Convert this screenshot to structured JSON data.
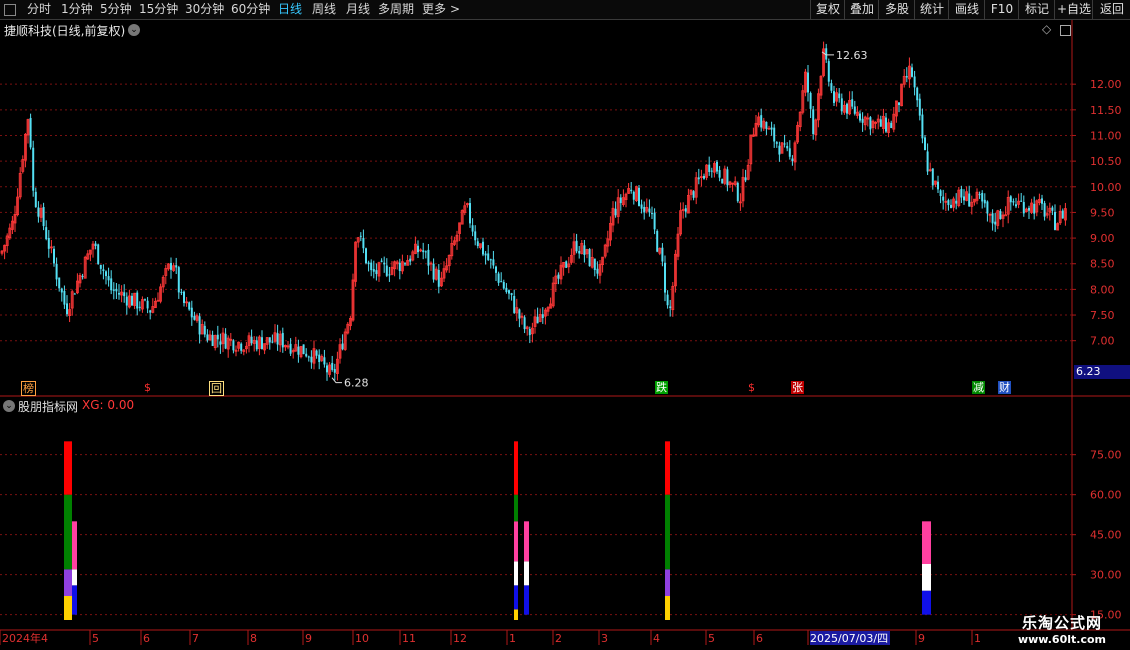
{
  "toolbar": {
    "periods": [
      "分时",
      "1分钟",
      "5分钟",
      "15分钟",
      "30分钟",
      "60分钟",
      "日线",
      "周线",
      "月线",
      "多周期",
      "更多"
    ],
    "active_period": "日线",
    "right_buttons": [
      "复权",
      "叠加",
      "多股",
      "统计",
      "画线",
      "F10",
      "标记",
      "+自选",
      "返回"
    ]
  },
  "main_chart": {
    "title": "捷顺科技(日线,前复权)",
    "high_label": "12.63",
    "low_label": "6.28",
    "current_price": "6.23",
    "y_ticks": [
      "12.00",
      "11.50",
      "11.00",
      "10.50",
      "10.00",
      "9.50",
      "9.00",
      "8.50",
      "8.00",
      "7.50",
      "7.00"
    ],
    "markers": [
      {
        "text": "榜",
        "color": "#ffa040",
        "boxed": true
      },
      {
        "text": "$",
        "color": "#ff3030",
        "boxed": false
      },
      {
        "text": "回",
        "color": "#ffe080",
        "boxed": true
      },
      {
        "text": "跌",
        "color": "#ffffff",
        "bg": "#00a000",
        "boxed": false
      },
      {
        "text": "$",
        "color": "#ff3030",
        "boxed": false
      },
      {
        "text": "张",
        "color": "#ffffff",
        "bg": "#c00000",
        "boxed": false
      },
      {
        "text": "减",
        "color": "#ffffff",
        "bg": "#008800",
        "boxed": false
      },
      {
        "text": "财",
        "color": "#ffffff",
        "bg": "#2050c0",
        "boxed": false
      }
    ],
    "colors": {
      "up": "#ff3838",
      "down": "#54e0f4",
      "grid": "#7a1010",
      "axis": "#b01818"
    }
  },
  "indicator": {
    "title": "股朋指标网",
    "xg_label": "XG: 0.00",
    "y_ticks": [
      "75.00",
      "60.00",
      "45.00",
      "30.00",
      "15.00"
    ]
  },
  "x_axis": {
    "labels": [
      "2024年4",
      "5",
      "6",
      "7",
      "8",
      "9",
      "10",
      "11",
      "12",
      "1",
      "2",
      "3",
      "4",
      "5",
      "6",
      "2025/07/03/四",
      "9",
      "1"
    ]
  },
  "watermark": {
    "line1": "乐淘公式网",
    "line2": "www.60lt.com"
  },
  "chart_data": {
    "type": "candlestick",
    "title": "捷顺科技(日线,前复权)",
    "ylim": [
      6.0,
      12.9
    ],
    "y_ticks": [
      7.0,
      7.5,
      8.0,
      8.5,
      9.0,
      9.5,
      10.0,
      10.5,
      11.0,
      11.5,
      12.0
    ],
    "x_labels": [
      "2024年4",
      "5",
      "6",
      "7",
      "8",
      "9",
      "10",
      "11",
      "12",
      "1",
      "2",
      "3",
      "4",
      "5",
      "6",
      "2025/07/03/四",
      "9",
      "1"
    ],
    "max_price": 12.63,
    "min_price": 6.28,
    "last_price": 6.23,
    "indicator": {
      "name": "股朋指标网",
      "ylim": [
        10,
        88
      ],
      "bar_segments": [
        {
          "position": "2024-04",
          "series": [
            {
              "from": 13,
              "to": 22,
              "color": "#ffd000"
            },
            {
              "from": 22,
              "to": 32,
              "color": "#9040e0"
            },
            {
              "from": 32,
              "to": 60,
              "color": "#008000"
            },
            {
              "from": 60,
              "to": 80,
              "color": "#ff0000"
            }
          ]
        },
        {
          "position": "2024-04b",
          "series": [
            {
              "from": 15,
              "to": 26,
              "color": "#1010e8"
            },
            {
              "from": 26,
              "to": 32,
              "color": "#ffffff"
            },
            {
              "from": 32,
              "to": 50,
              "color": "#ff40a0"
            }
          ]
        },
        {
          "position": "2025-01",
          "series": [
            {
              "from": 13,
              "to": 17,
              "color": "#ffd000"
            },
            {
              "from": 17,
              "to": 26,
              "color": "#1010e8"
            },
            {
              "from": 26,
              "to": 35,
              "color": "#ffffff"
            },
            {
              "from": 35,
              "to": 50,
              "color": "#ff40a0"
            },
            {
              "from": 50,
              "to": 60,
              "color": "#008000"
            },
            {
              "from": 60,
              "to": 80,
              "color": "#ff0000"
            }
          ]
        },
        {
          "position": "2025-01b",
          "series": [
            {
              "from": 15,
              "to": 26,
              "color": "#1010e8"
            },
            {
              "from": 26,
              "to": 35,
              "color": "#ffffff"
            },
            {
              "from": 35,
              "to": 50,
              "color": "#ff40a0"
            }
          ]
        },
        {
          "position": "2025-04",
          "series": [
            {
              "from": 13,
              "to": 22,
              "color": "#ffd000"
            },
            {
              "from": 22,
              "to": 32,
              "color": "#9040e0"
            },
            {
              "from": 32,
              "to": 60,
              "color": "#008000"
            },
            {
              "from": 60,
              "to": 80,
              "color": "#ff0000"
            }
          ]
        },
        {
          "position": "2025-09",
          "series": [
            {
              "from": 15,
              "to": 24,
              "color": "#1010e8"
            },
            {
              "from": 24,
              "to": 34,
              "color": "#ffffff"
            },
            {
              "from": 34,
              "to": 50,
              "color": "#ff40a0"
            }
          ]
        }
      ]
    }
  }
}
